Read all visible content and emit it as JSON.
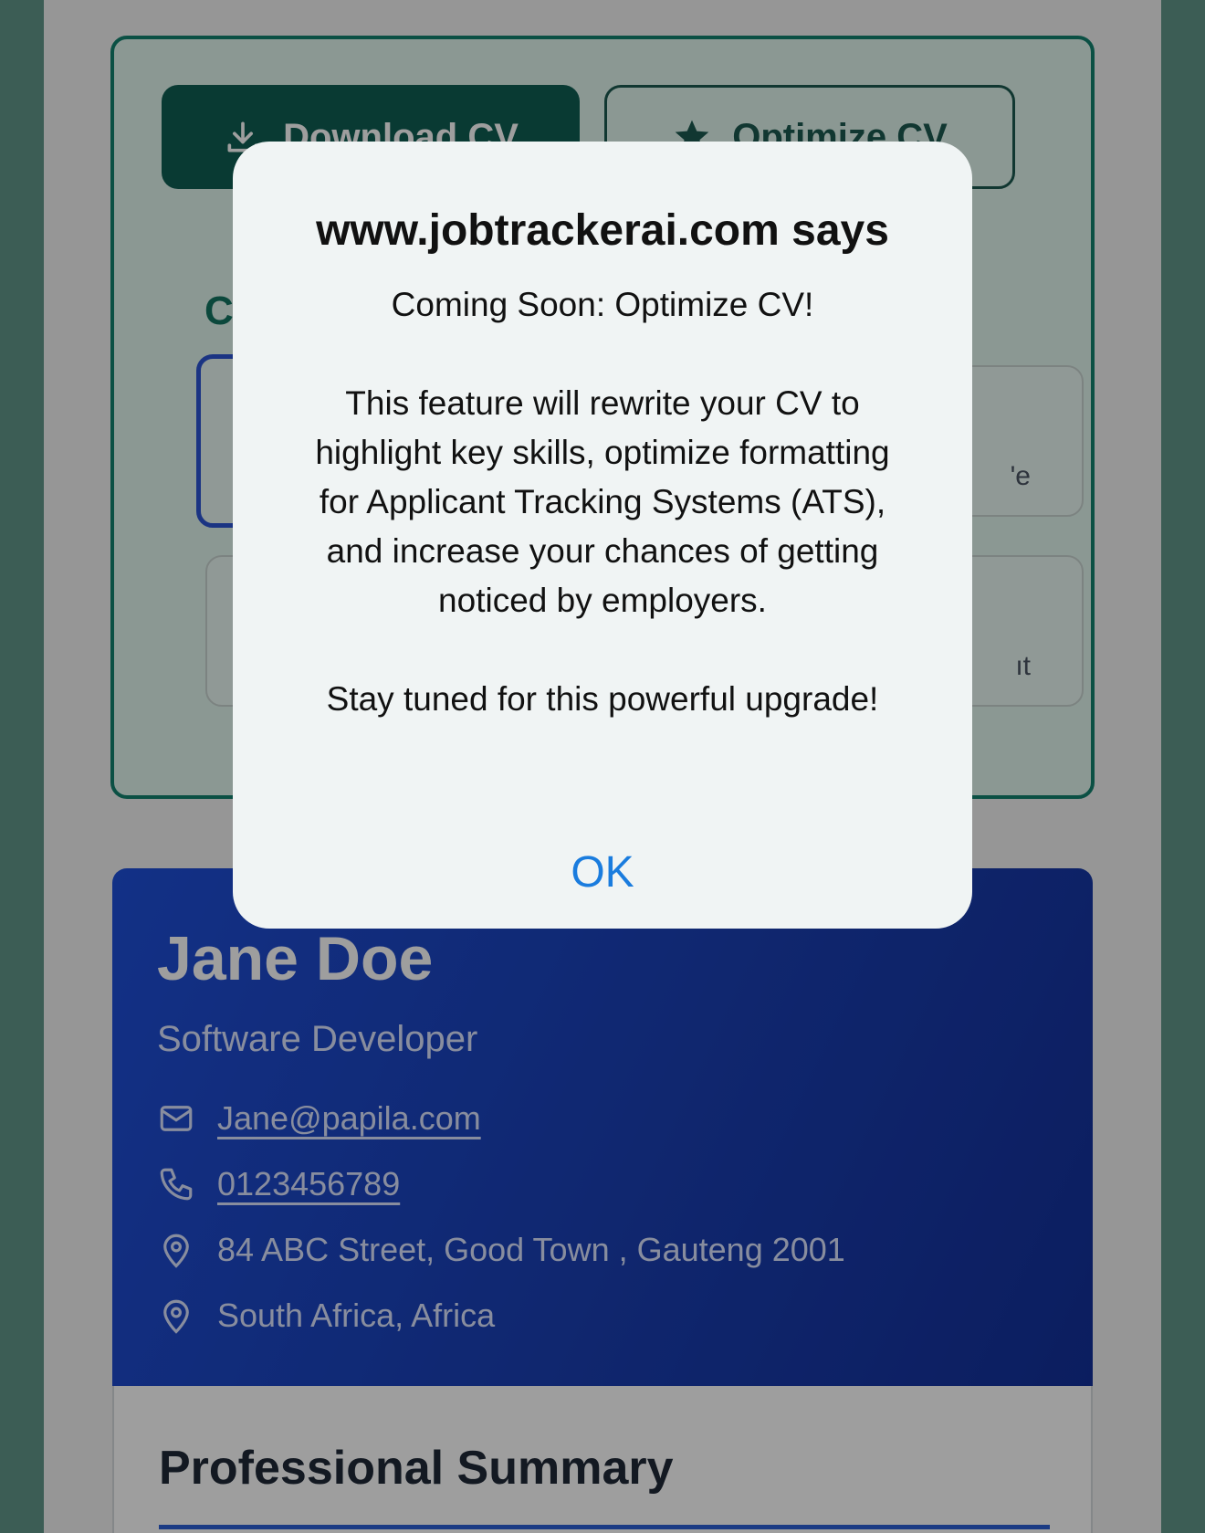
{
  "actions": {
    "download_label": "Download CV",
    "optimize_label": "Optimize CV"
  },
  "section_partial": "C",
  "option_cards": [
    {
      "partial_text": ""
    },
    {
      "partial_text": "'e"
    },
    {
      "partial_text": ""
    },
    {
      "partial_text": "ıt"
    }
  ],
  "profile": {
    "name": "Jane Doe",
    "title": "Software Developer",
    "email": "Jane@papila.com",
    "phone": "0123456789",
    "address": "84 ABC Street, Good Town , Gauteng 2001",
    "region": "South Africa, Africa"
  },
  "summary": {
    "heading": "Professional Summary"
  },
  "dialog": {
    "title": "www.jobtrackerai.com says",
    "line1": "Coming Soon: Optimize CV!",
    "line2": "This feature will rewrite your CV to highlight key skills, optimize formatting for Applicant Tracking Systems (ATS), and increase your chances of getting noticed by employers.",
    "line3": "Stay tuned for this powerful upgrade!",
    "ok_label": "OK"
  },
  "colors": {
    "accent_green": "#0f5e53",
    "profile_blue": "#1e4fd9",
    "ok_blue": "#1a7cde"
  }
}
